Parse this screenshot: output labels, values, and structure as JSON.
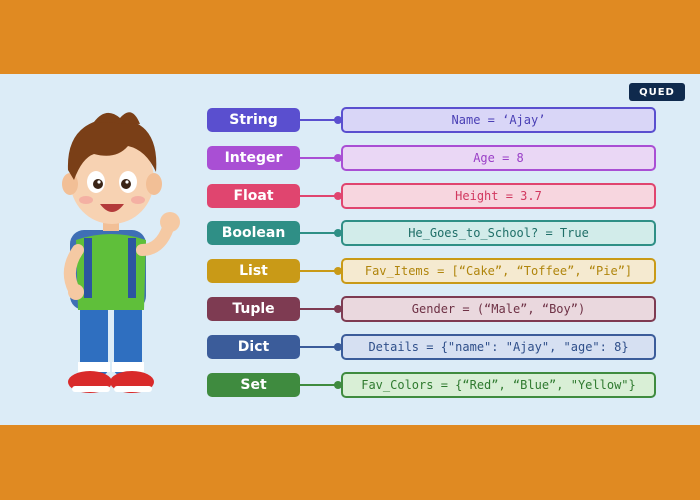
{
  "logo": {
    "text": "QUED"
  },
  "rows": [
    {
      "type": "String",
      "example": "Name = ‘Ajay’",
      "color": "#5a4fcf",
      "bg": "#d9d6f7",
      "text_color": "#4a3fb5"
    },
    {
      "type": "Integer",
      "example": "Age = 8",
      "color": "#a94fd4",
      "bg": "#ead7f5",
      "text_color": "#9a3fc7"
    },
    {
      "type": "Float",
      "example": "Height = 3.7",
      "color": "#e0456f",
      "bg": "#f7d6df",
      "text_color": "#d1385f"
    },
    {
      "type": "Boolean",
      "example": "He_Goes_to_School? = True",
      "color": "#2f8f86",
      "bg": "#d2ecea",
      "text_color": "#1f6f68"
    },
    {
      "type": "List",
      "example": "Fav_Items = [“Cake”, “Toffee”, “Pie”]",
      "color": "#c99a17",
      "bg": "#f5ead0",
      "text_color": "#b0850c"
    },
    {
      "type": "Tuple",
      "example": "Gender = (“Male”, “Boy”)",
      "color": "#7e3b52",
      "bg": "#ead8de",
      "text_color": "#6e3145"
    },
    {
      "type": "Dict",
      "example": "Details = {\"name\": \"Ajay\", \"age\": 8}",
      "color": "#3b5c9a",
      "bg": "#d6e0f2",
      "text_color": "#2f4f8a"
    },
    {
      "type": "Set",
      "example": "Fav_Colors = {“Red”, “Blue”, \"Yellow\"}",
      "color": "#3f8b3f",
      "bg": "#d9efd6",
      "text_color": "#2f7a2f"
    }
  ]
}
